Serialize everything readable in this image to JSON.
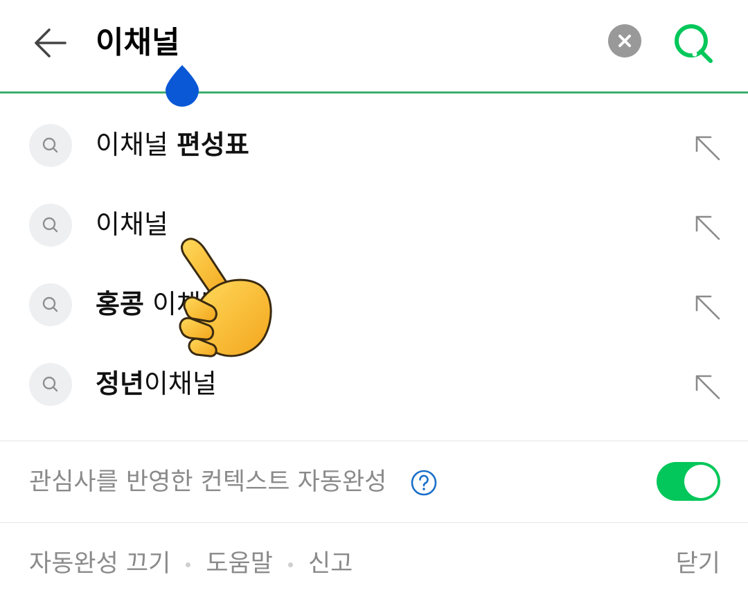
{
  "search": {
    "query": "이채널"
  },
  "suggestions": [
    {
      "parts": [
        {
          "text": "이채널 ",
          "bold": false
        },
        {
          "text": "편성표",
          "bold": true
        }
      ]
    },
    {
      "parts": [
        {
          "text": "이채널",
          "bold": false
        }
      ]
    },
    {
      "parts": [
        {
          "text": "홍콩",
          "bold": true
        },
        {
          "text": " 이채널",
          "bold": false
        }
      ]
    },
    {
      "parts": [
        {
          "text": "정년",
          "bold": true
        },
        {
          "text": "이채널",
          "bold": false
        }
      ]
    }
  ],
  "context_autocomplete": {
    "label": "관심사를 반영한 컨텍스트 자동완성",
    "enabled": true
  },
  "footer": {
    "disable_autocomplete": "자동완성 끄기",
    "help": "도움말",
    "report": "신고",
    "close": "닫기"
  },
  "icons": {
    "back": "back-arrow-icon",
    "clear": "clear-icon",
    "search": "search-icon",
    "suggestion": "search-icon",
    "fill": "arrow-up-left-icon",
    "help": "question-circle-icon",
    "finger": "pointing-hand-icon"
  },
  "colors": {
    "accent": "#03c75a",
    "underline": "#3dae6e",
    "cursor_handle": "#0a58d6",
    "muted_text": "#8a8a8a"
  }
}
